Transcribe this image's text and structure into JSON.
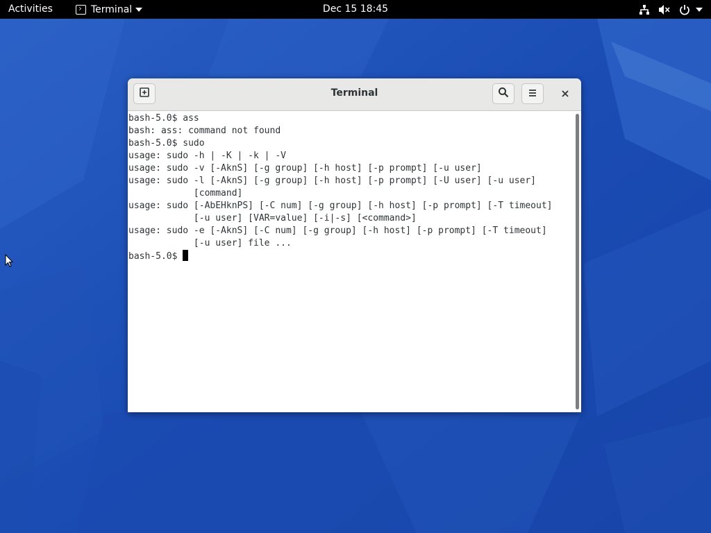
{
  "topbar": {
    "activities_label": "Activities",
    "app_name": "Terminal",
    "clock": "Dec 15  18:45",
    "tray_icons": [
      "network-icon",
      "volume-muted-icon",
      "power-icon",
      "chevron-down-icon"
    ]
  },
  "window": {
    "title": "Terminal",
    "buttons": [
      "new-tab-icon",
      "search-icon",
      "hamburger-menu-icon",
      "close-icon"
    ]
  },
  "terminal": {
    "output": "bash-5.0$ ass\nbash: ass: command not found\nbash-5.0$ sudo\nusage: sudo -h | -K | -k | -V\nusage: sudo -v [-AknS] [-g group] [-h host] [-p prompt] [-u user]\nusage: sudo -l [-AknS] [-g group] [-h host] [-p prompt] [-U user] [-u user]\n            [command]\nusage: sudo [-AbEHknPS] [-C num] [-g group] [-h host] [-p prompt] [-T timeout]\n            [-u user] [VAR=value] [-i|-s] [<command>]\nusage: sudo -e [-AknS] [-C num] [-g group] [-h host] [-p prompt] [-T timeout]\n            [-u user] file ...",
    "current_prompt": "bash-5.0$"
  },
  "colors": {
    "topbar_bg": "#000000",
    "wallpaper_base": "#1a4fb8",
    "headerbar_bg": "#e8e8e7",
    "terminal_bg": "#ffffff",
    "terminal_fg": "#2e3436"
  }
}
